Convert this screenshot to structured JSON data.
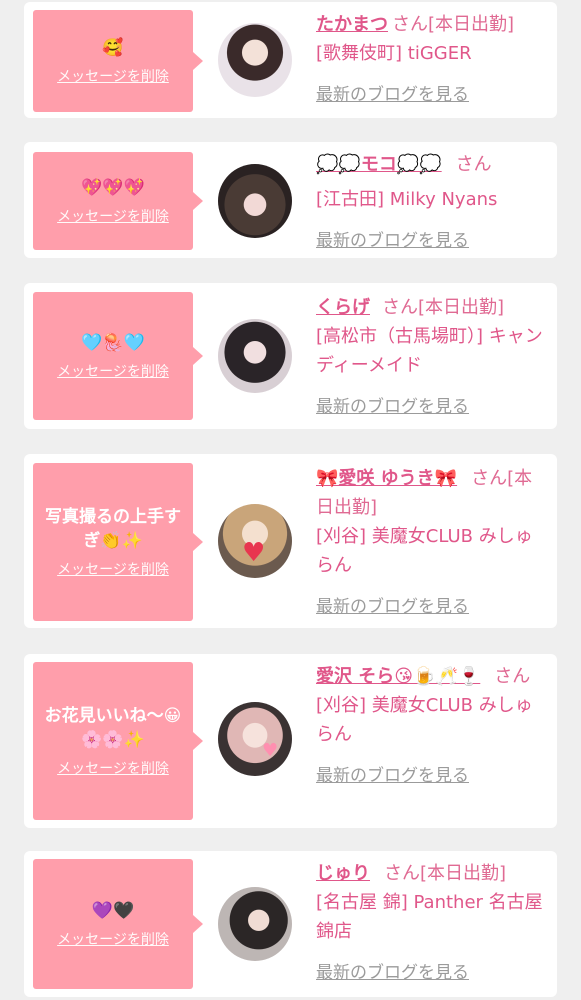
{
  "colors": {
    "accent": "#e0578a",
    "bubble": "#ff9eab",
    "link_gray": "#9b9b9b"
  },
  "delete_label": "メッセージを削除",
  "blog_label": "最新のブログを見る",
  "suffix": "さん",
  "items": [
    {
      "message": "🥰",
      "name": "たかまつ",
      "status": "[本日出勤]",
      "shop": "[歌舞伎町] tiGGER",
      "avatar_icon": "avatar-photo"
    },
    {
      "message": "💖💖💖",
      "name": "💭💭モコ💭💭",
      "status": "",
      "shop": "[江古田] Milky Nyans",
      "avatar_icon": "avatar-photo"
    },
    {
      "message": "🩵🪼🩵",
      "name": "くらげ",
      "status": "[本日出勤]",
      "shop": "[高松市（古馬場町）] キャンディーメイド",
      "avatar_icon": "avatar-photo"
    },
    {
      "message": "写真撮るの上手すぎ👏✨",
      "name": "🎀愛咲 ゆうき🎀",
      "status": "[本日出勤]",
      "shop": "[刈谷] 美魔女CLUB みしゅらん",
      "avatar_icon": "avatar-photo"
    },
    {
      "message": "お花見いいね〜😀🌸🌸✨",
      "name": "愛沢 そら😘🍺🥂🍷",
      "status": "",
      "shop": "[刈谷] 美魔女CLUB みしゅらん",
      "avatar_icon": "avatar-photo"
    },
    {
      "message": "💜🖤",
      "name": "じゅり",
      "status": "[本日出勤]",
      "shop": "[名古屋 錦] Panther 名古屋錦店",
      "avatar_icon": "avatar-photo"
    }
  ]
}
